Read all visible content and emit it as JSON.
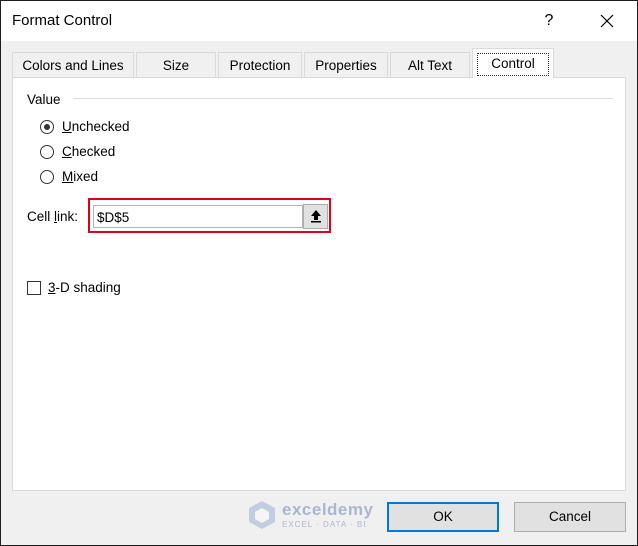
{
  "window": {
    "title": "Format Control",
    "help_label": "?",
    "close_icon": "close-icon"
  },
  "tabs": [
    {
      "label": "Colors and Lines",
      "active": false
    },
    {
      "label": "Size",
      "active": false
    },
    {
      "label": "Protection",
      "active": false
    },
    {
      "label": "Properties",
      "active": false
    },
    {
      "label": "Alt Text",
      "active": false
    },
    {
      "label": "Control",
      "active": true
    }
  ],
  "value_group": {
    "label": "Value",
    "options": [
      {
        "accel": "U",
        "rest": "nchecked",
        "selected": true
      },
      {
        "accel": "C",
        "rest": "hecked",
        "selected": false
      },
      {
        "accel": "M",
        "rest": "ixed",
        "selected": false
      }
    ]
  },
  "cell_link": {
    "label_pre": "Cell ",
    "label_accel": "l",
    "label_post": "ink:",
    "value": "$D$5",
    "button_icon": "collapse-dialog-icon"
  },
  "shading": {
    "accel": "3",
    "rest": "-D shading",
    "checked": false
  },
  "watermark": {
    "name": "exceldemy",
    "tagline": "EXCEL · DATA · BI"
  },
  "buttons": {
    "ok": "OK",
    "cancel": "Cancel"
  },
  "colors": {
    "highlight": "#e0001b",
    "default_button_border": "#0078d7"
  }
}
